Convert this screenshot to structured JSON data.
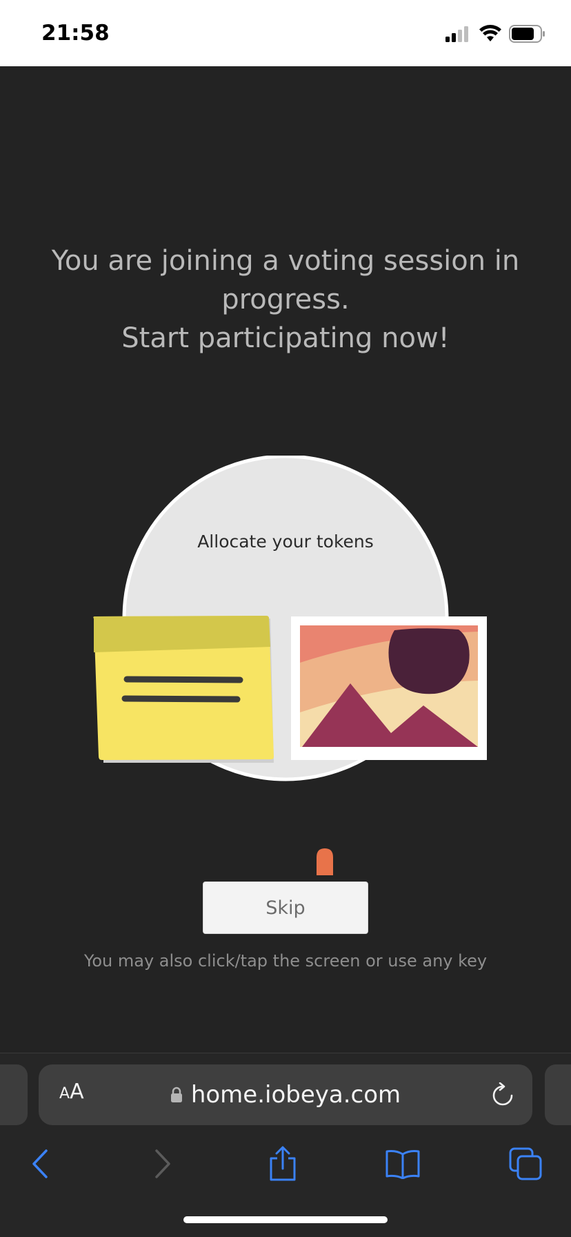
{
  "status_bar": {
    "time": "21:58"
  },
  "main": {
    "headline_line1": "You are joining a voting session in",
    "headline_line2": "progress.",
    "headline_line3": "Start participating now!",
    "illustration_caption": "Allocate your tokens",
    "skip_label": "Skip",
    "hint": "You may also click/tap the screen or use any key"
  },
  "browser": {
    "text_size_small": "A",
    "text_size_large": "A",
    "url": "home.iobeya.com",
    "icons": {
      "lock": "lock-icon",
      "reload": "reload-icon",
      "back": "back-chevron-icon",
      "forward": "forward-chevron-icon",
      "share": "share-icon",
      "bookmarks": "bookmarks-icon",
      "tabs": "tabs-icon"
    }
  },
  "colors": {
    "background": "#232323",
    "accent_blue": "#3b82f6",
    "sticky_yellow": "#f7e463",
    "token_orange": "#e8734a"
  }
}
